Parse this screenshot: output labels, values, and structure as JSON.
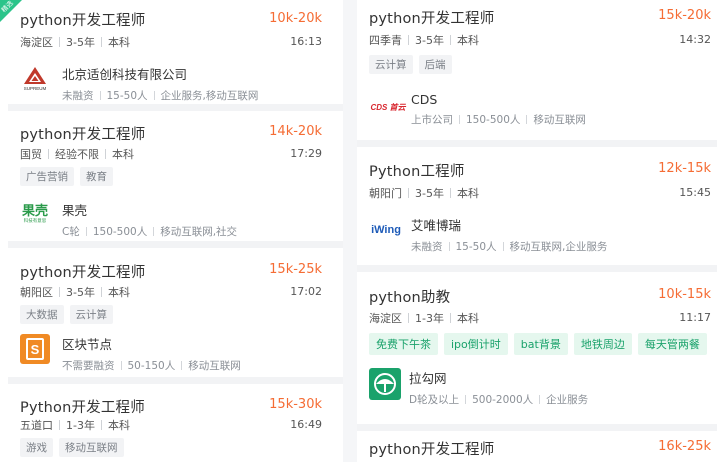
{
  "left": [
    {
      "badge": "精选",
      "title": "python开发工程师",
      "salary": "10k-20k",
      "meta": [
        "海淀区",
        "3-5年",
        "本科"
      ],
      "time": "16:13",
      "tags": [],
      "company": {
        "name": "北京适创科技有限公司",
        "meta": [
          "未融资",
          "15-50人",
          "企业服务,移动互联网"
        ],
        "logo_icon": "supreum-logo-icon",
        "logo_text": "SUPREUM"
      }
    },
    {
      "title": "python开发工程师",
      "salary": "14k-20k",
      "meta": [
        "国贸",
        "经验不限",
        "本科"
      ],
      "time": "17:29",
      "tags": [
        "广告营销",
        "教育"
      ],
      "company": {
        "name": "果壳",
        "meta": [
          "C轮",
          "150-500人",
          "移动互联网,社交"
        ],
        "logo_icon": "guokr-logo-icon",
        "logo_text": "果壳",
        "logo_sub": "科技有意思"
      }
    },
    {
      "title": "python开发工程师",
      "salary": "15k-25k",
      "meta": [
        "朝阳区",
        "3-5年",
        "本科"
      ],
      "time": "17:02",
      "tags": [
        "大数据",
        "云计算"
      ],
      "company": {
        "name": "区块节点",
        "meta": [
          "不需要融资",
          "50-150人",
          "移动互联网"
        ],
        "logo_icon": "block-node-logo-icon",
        "logo_text": "S"
      }
    },
    {
      "title": "Python开发工程师",
      "salary": "15k-30k",
      "meta": [
        "五道口",
        "1-3年",
        "本科"
      ],
      "time": "16:49",
      "tags": [
        "游戏",
        "移动互联网"
      ]
    }
  ],
  "right": [
    {
      "title": "python开发工程师",
      "salary": "15k-20k",
      "meta": [
        "四季青",
        "3-5年",
        "本科"
      ],
      "time": "14:32",
      "tags": [
        "云计算",
        "后端"
      ],
      "company": {
        "name": "CDS",
        "meta": [
          "上市公司",
          "150-500人",
          "移动互联网"
        ],
        "logo_icon": "cds-logo-icon",
        "logo_text": "CDS 首云"
      }
    },
    {
      "title": "Python工程师",
      "salary": "12k-15k",
      "meta": [
        "朝阳门",
        "3-5年",
        "本科"
      ],
      "time": "15:45",
      "tags": [],
      "company": {
        "name": "艾唯博瑞",
        "meta": [
          "未融资",
          "15-50人",
          "移动互联网,企业服务"
        ],
        "logo_icon": "iwing-logo-icon",
        "logo_text": "iWing"
      }
    },
    {
      "title": "python助教",
      "salary": "10k-15k",
      "meta": [
        "海淀区",
        "1-3年",
        "本科"
      ],
      "time": "11:17",
      "tags": [
        "免费下午茶",
        "ipo倒计时",
        "bat背景",
        "地铁周边",
        "每天管两餐"
      ],
      "company": {
        "name": "拉勾网",
        "meta": [
          "D轮及以上",
          "500-2000人",
          "企业服务"
        ],
        "logo_icon": "lagou-logo-icon"
      }
    },
    {
      "title": "python开发工程师",
      "salary": "16k-25k"
    }
  ],
  "colors": {
    "salary": "#f56c34",
    "tag_green": "#1aa26b",
    "badge": "#2bc48a"
  }
}
